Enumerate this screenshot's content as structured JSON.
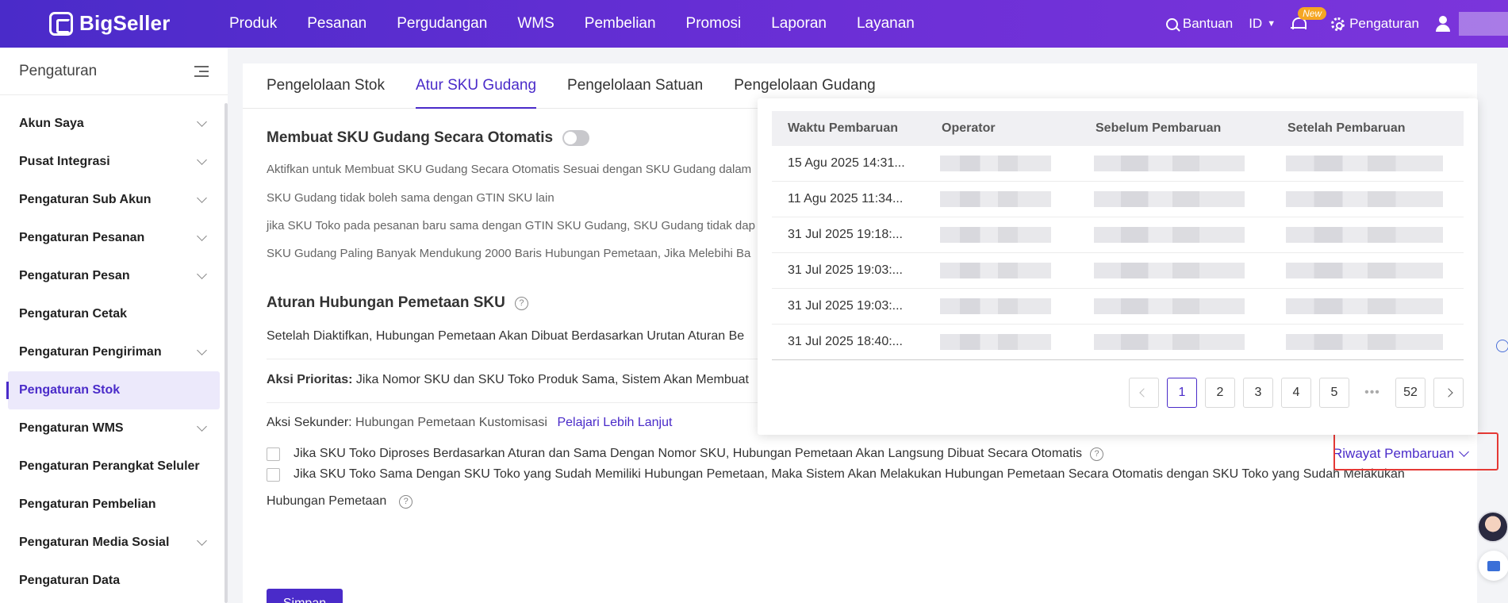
{
  "brand": {
    "name": "BigSeller"
  },
  "nav": [
    "Produk",
    "Pesanan",
    "Pergudangan",
    "WMS",
    "Pembelian",
    "Promosi",
    "Laporan",
    "Layanan"
  ],
  "topbar": {
    "help": "Bantuan",
    "language": "ID",
    "new_badge": "New",
    "settings": "Pengaturan"
  },
  "sidebar": {
    "title": "Pengaturan",
    "items": [
      {
        "label": "Akun Saya",
        "expandable": true
      },
      {
        "label": "Pusat Integrasi",
        "expandable": true
      },
      {
        "label": "Pengaturan Sub Akun",
        "expandable": true
      },
      {
        "label": "Pengaturan Pesanan",
        "expandable": true
      },
      {
        "label": "Pengaturan Pesan",
        "expandable": true
      },
      {
        "label": "Pengaturan Cetak",
        "expandable": false
      },
      {
        "label": "Pengaturan Pengiriman",
        "expandable": true
      },
      {
        "label": "Pengaturan Stok",
        "expandable": false,
        "active": true
      },
      {
        "label": "Pengaturan WMS",
        "expandable": true
      },
      {
        "label": "Pengaturan Perangkat Seluler",
        "expandable": false
      },
      {
        "label": "Pengaturan Pembelian",
        "expandable": false
      },
      {
        "label": "Pengaturan Media Sosial",
        "expandable": true
      },
      {
        "label": "Pengaturan Data",
        "expandable": false
      }
    ]
  },
  "tabs": [
    {
      "label": "Pengelolaan Stok",
      "active": false
    },
    {
      "label": "Atur SKU Gudang",
      "active": true
    },
    {
      "label": "Pengelolaan Satuan",
      "active": false
    },
    {
      "label": "Pengelolaan Gudang",
      "active": false
    }
  ],
  "section1": {
    "title": "Membuat SKU Gudang Secara Otomatis",
    "toggle_on": false,
    "descriptions": [
      "Aktifkan untuk Membuat SKU Gudang Secara Otomatis Sesuai dengan SKU Gudang dalam",
      "SKU Gudang tidak boleh sama dengan GTIN SKU lain",
      "jika SKU Toko pada pesanan baru sama dengan GTIN SKU Gudang, SKU Gudang tidak dap",
      "SKU Gudang Paling Banyak Mendukung 2000 Baris Hubungan Pemetaan, Jika Melebihi Ba"
    ]
  },
  "section2": {
    "title": "Aturan Hubungan Pemetaan SKU",
    "intro": "Setelah Diaktifkan, Hubungan Pemetaan Akan Dibuat Berdasarkan Urutan Aturan Be",
    "primary_label": "Aksi Prioritas:",
    "primary_text": " Jika Nomor SKU dan SKU Toko Produk Sama, Sistem Akan Membuat",
    "secondary_label": "Aksi Sekunder:",
    "secondary_text": " Hubungan Pemetaan Kustomisasi",
    "learn_more": "Pelajari Lebih Lanjut",
    "option1": "Jika SKU Toko Diproses Berdasarkan Aturan dan Sama Dengan Nomor SKU, Hubungan Pemetaan Akan Langsung Dibuat Secara Otomatis",
    "option2_line1": "Jika SKU Toko Sama Dengan SKU Toko yang Sudah Memiliki Hubungan Pemetaan, Maka Sistem Akan Melakukan Hubungan Pemetaan Secara Otomatis dengan SKU Toko yang Sudah Melakukan",
    "option2_line2": "Hubungan Pemetaan",
    "history_link": "Riwayat Pembaruan",
    "save": "Simpan"
  },
  "history_popup": {
    "columns": [
      "Waktu Pembaruan",
      "Operator",
      "Sebelum Pembaruan",
      "Setelah Pembaruan"
    ],
    "rows": [
      "15 Agu 2025 14:31...",
      "11 Agu 2025 11:34...",
      "31 Jul 2025 19:18:...",
      "31 Jul 2025 19:03:...",
      "31 Jul 2025 19:03:...",
      "31 Jul 2025 18:40:..."
    ],
    "pagination": {
      "pages": [
        "1",
        "2",
        "3",
        "4",
        "5"
      ],
      "ellipsis": "•••",
      "last": "52",
      "current": "1"
    }
  },
  "colors": {
    "brand": "#4a2bc9",
    "annotation": "#e53935"
  }
}
